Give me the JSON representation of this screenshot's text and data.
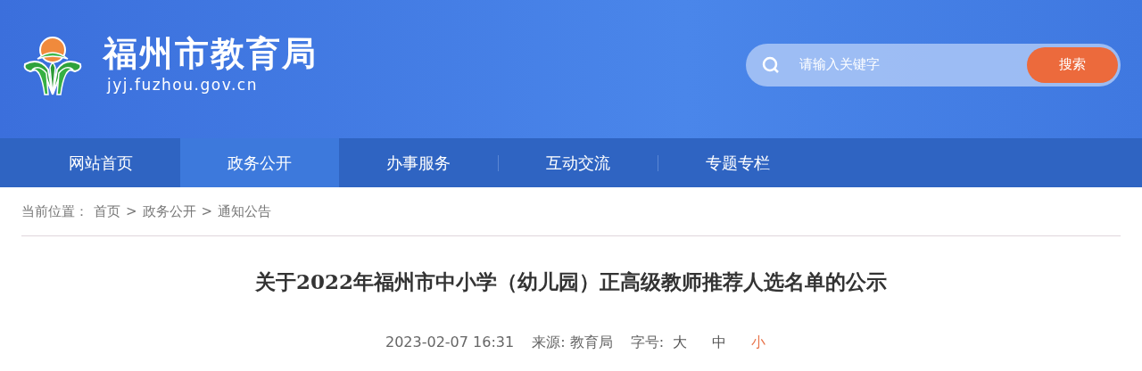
{
  "header": {
    "site_name": "福州市教育局",
    "domain": "jyj.fuzhou.gov.cn"
  },
  "search": {
    "placeholder": "请输入关键字",
    "button": "搜索"
  },
  "nav": [
    {
      "label": "网站首页",
      "selected": false
    },
    {
      "label": "政务公开",
      "selected": true
    },
    {
      "label": "办事服务",
      "selected": false
    },
    {
      "label": "互动交流",
      "selected": false
    },
    {
      "label": "专题专栏",
      "selected": false
    }
  ],
  "breadcrumb": {
    "prefix": "当前位置：",
    "separator": ">",
    "items": [
      "首页",
      "政务公开",
      "通知公告"
    ]
  },
  "article": {
    "title": "关于2022年福州市中小学（幼儿园）正高级教师推荐人选名单的公示",
    "date": "2023-02-07 16:31",
    "source": "来源: 教育局",
    "font_size_label": "字号:",
    "font_sizes": [
      {
        "label": "大",
        "selected": false
      },
      {
        "label": "中",
        "selected": false
      },
      {
        "label": "小",
        "selected": true
      }
    ]
  }
}
